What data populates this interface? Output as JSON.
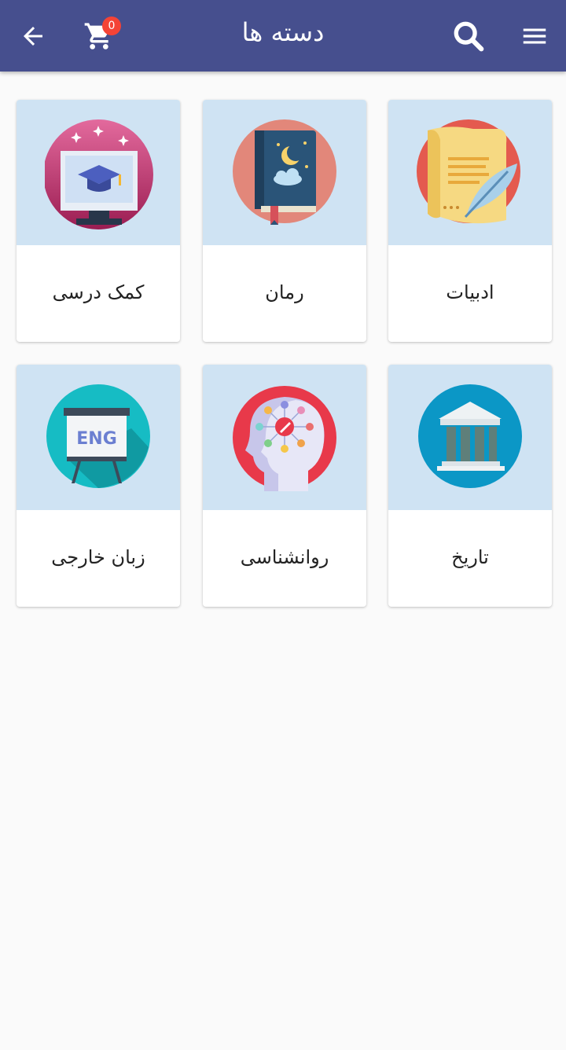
{
  "appbar": {
    "title": "دسته ها",
    "cart_count": "0",
    "icons": {
      "menu": "menu-icon",
      "search": "search-icon",
      "cart": "cart-icon",
      "back": "arrow-back-icon"
    }
  },
  "colors": {
    "primary": "#464f8e",
    "badge": "#f44336",
    "card_media_bg": "#cfe3f3"
  },
  "categories": [
    {
      "label": "ادبیات",
      "icon": "literature-scroll-quill-icon"
    },
    {
      "label": "رمان",
      "icon": "novel-book-icon"
    },
    {
      "label": "کمک درسی",
      "icon": "education-graduation-cap-icon"
    },
    {
      "label": "تاریخ",
      "icon": "history-building-columns-icon"
    },
    {
      "label": "روانشناسی",
      "icon": "psychology-head-icon"
    },
    {
      "label": "زبان خارجی",
      "icon": "foreign-language-eng-board-icon"
    }
  ]
}
